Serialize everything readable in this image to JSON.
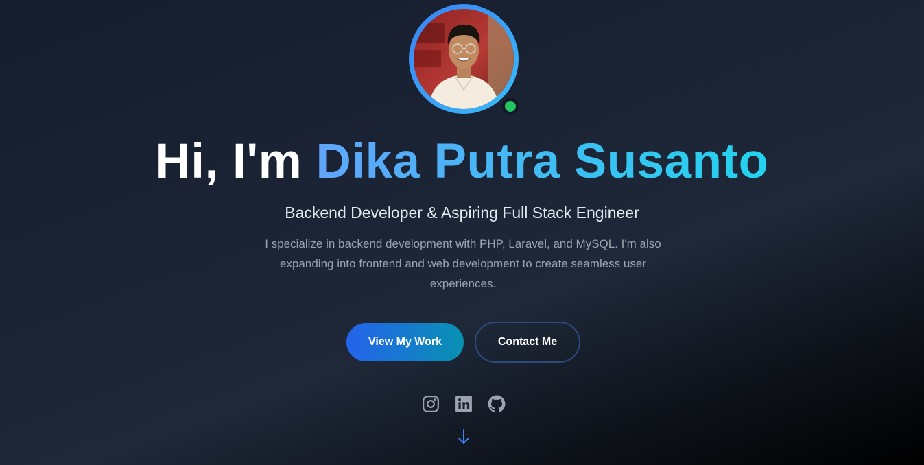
{
  "hero": {
    "greeting": "Hi, I'm",
    "name": "Dika Putra Susanto",
    "subtitle": "Backend Developer & Aspiring Full Stack Engineer",
    "description": "I specialize in backend development with PHP, Laravel, and MySQL. I'm also expanding into frontend and web development to create seamless user experiences."
  },
  "buttons": {
    "primary_label": "View My Work",
    "secondary_label": "Contact Me"
  },
  "socials": [
    {
      "icon": "instagram-icon"
    },
    {
      "icon": "linkedin-icon"
    },
    {
      "icon": "github-icon"
    }
  ],
  "status": {
    "icon": "online-status-dot"
  },
  "scroll": {
    "icon": "arrow-down-icon"
  },
  "colors": {
    "accent_from": "#60a5fa",
    "accent_to": "#22d3ee",
    "status_online": "#22c55e",
    "icon_color": "#9ca3af",
    "arrow_color": "#3b82f6"
  }
}
